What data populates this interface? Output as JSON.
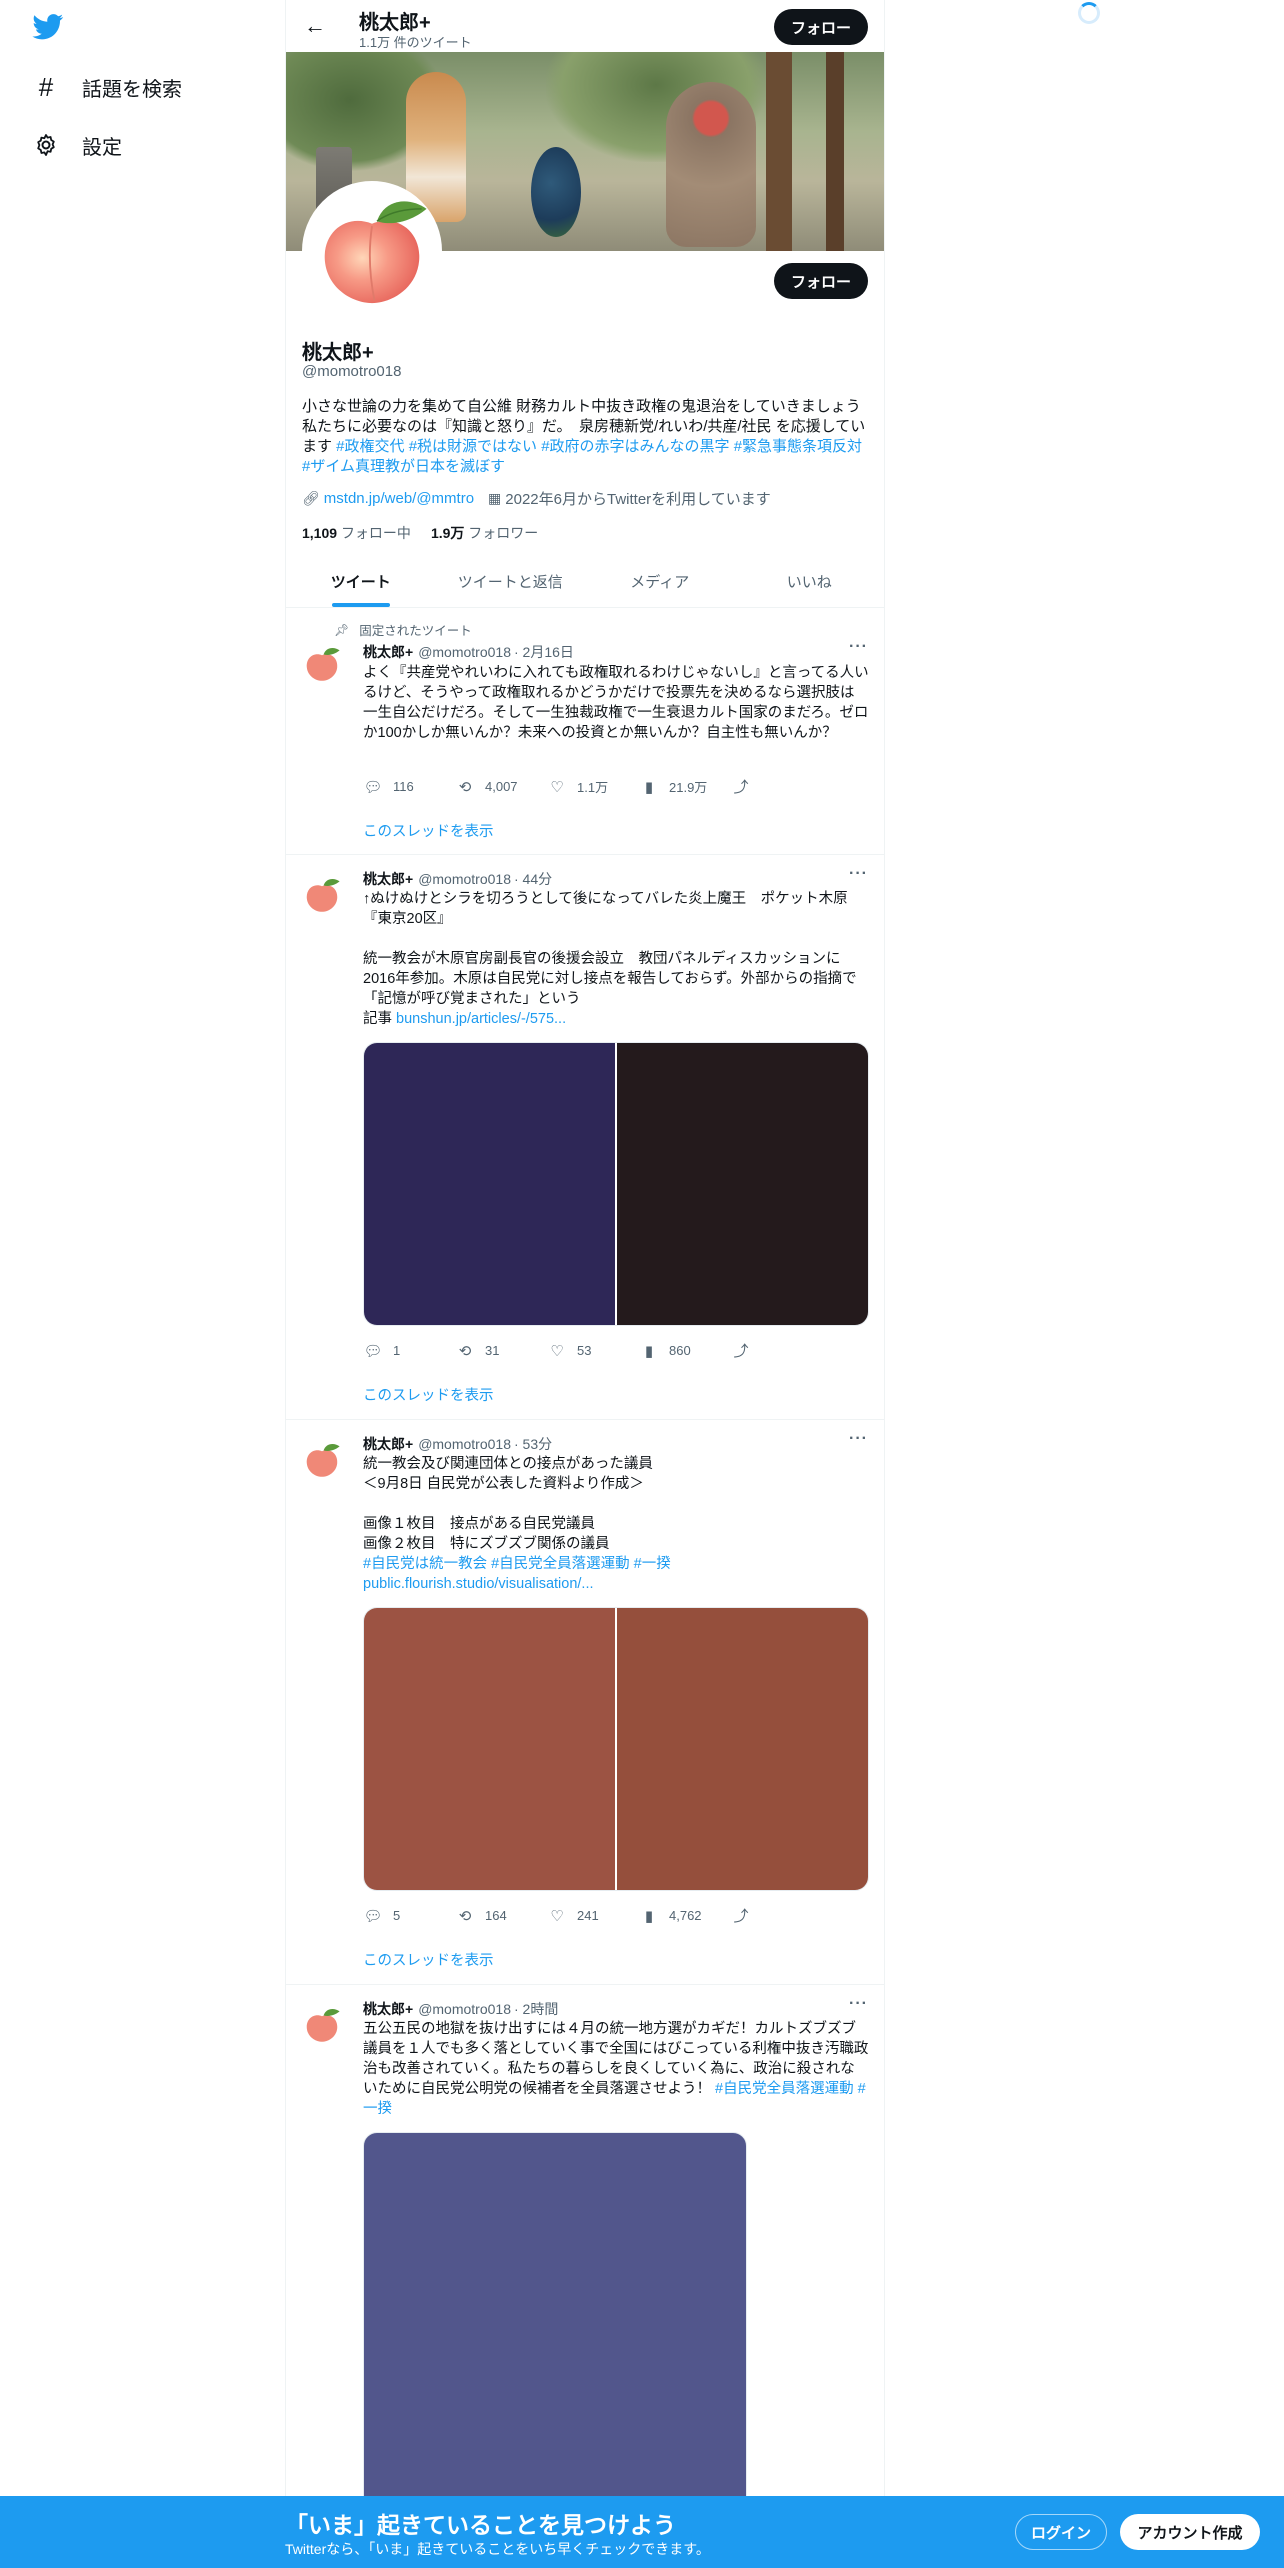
{
  "nav": {
    "explore_label": "話題を検索",
    "settings_label": "設定"
  },
  "header": {
    "name": "桃太郎+",
    "tweet_count": "1.1万 件のツイート",
    "follow_label": "フォロー"
  },
  "profile": {
    "name": "桃太郎+",
    "handle": "@momotro018",
    "follow_label": "フォロー",
    "bio_text": "小さな世論の力を集めて自公維 財務カルト中抜き政権の鬼退治をしていきましょう　私たちに必要なのは『知識と怒り』だ。　泉房穂新党/れいわ/共産/社民 を応援しています ",
    "bio_hashtags": [
      "#政権交代",
      "#税は財源ではない",
      "#政府の赤字はみんなの黒字",
      "#緊急事態条項反対",
      "#ザイム真理教が日本を滅ぼす"
    ],
    "website": "mstdn.jp/web/@mmtro",
    "joined": "2022年6月からTwitterを利用しています",
    "following_count": "1,109",
    "following_label": "フォロー中",
    "followers_count": "1.9万",
    "followers_label": "フォロワー"
  },
  "tabs": [
    "ツイート",
    "ツイートと返信",
    "メディア",
    "いいね"
  ],
  "tweets": [
    {
      "pinned_label": "固定されたツイート",
      "name": "桃太郎+",
      "handle": "@momotro018",
      "time": "· 2月16日",
      "text": "よく『共産党やれいわに入れても政権取れるわけじゃないし』と言ってる人いるけど、そうやって政権取れるかどうかだけで投票先を決めるなら選択肢は一生自公だけだろ。そして一生独裁政権で一生衰退カルト国家のまだろ。ゼロか100かしか無いんか？未来への投資とか無いんか？自主性も無いんか？",
      "replies": "116",
      "retweets": "4,007",
      "likes": "1.1万",
      "views": "21.9万",
      "thread_label": "このスレッドを表示"
    },
    {
      "name": "桃太郎+",
      "handle": "@momotro018",
      "time": "· 44分",
      "text": "↑ぬけぬけとシラを切ろうとして後になってバレた炎上魔王　ポケット木原『東京20区』\n\n統一教会が木原官房副長官の後援会設立　教団パネルディスカッションに2016年参加。木原は自民党に対し接点を報告しておらず。外部からの指摘で「記憶が呼び覚まされた」という\n記事 ",
      "link": "bunshun.jp/articles/-/575...",
      "media_colors": [
        "#2e2757",
        "#241a1c"
      ],
      "replies": "1",
      "retweets": "31",
      "likes": "53",
      "views": "860",
      "thread_label": "このスレッドを表示"
    },
    {
      "name": "桃太郎+",
      "handle": "@momotro018",
      "time": "· 53分",
      "text": "統一教会及び関連団体との接点があった議員\n＜9月8日 自民党が公表した資料より作成＞\n\n画像１枚目　接点がある自民党議員\n画像２枚目　特にズブズブ関係の議員",
      "hashtags": "#自民党は統一教会 #自民党全員落選運動 #一揆",
      "link": "public.flourish.studio/visualisation/...",
      "media_colors": [
        "#9c5343",
        "#954f3c"
      ],
      "replies": "5",
      "retweets": "164",
      "likes": "241",
      "views": "4,762",
      "thread_label": "このスレッドを表示"
    },
    {
      "name": "桃太郎+",
      "handle": "@momotro018",
      "time": "· 2時間",
      "text": "五公五民の地獄を抜け出すには４月の統一地方選がカギだ！カルトズブズブ議員を１人でも多く落としていく事で全国にはびこっている利権中抜き汚職政治も改善されていく。私たちの暮らしを良くしていく為に、政治に殺されないために自民党公明党の候補者を全員落選させよう！ ",
      "hashtags": "#自民党全員落選運動 #一揆",
      "media_colors": [
        "#52568c"
      ]
    }
  ],
  "bottom": {
    "title": "「いま」起きていることを見つけよう",
    "subtitle": "Twitterなら、「いま」起きていることをいち早くチェックできます。",
    "login": "ログイン",
    "signup": "アカウント作成"
  },
  "colors": {
    "accent": "#1d9bf0",
    "text": "#0f1419",
    "muted": "#536471"
  }
}
